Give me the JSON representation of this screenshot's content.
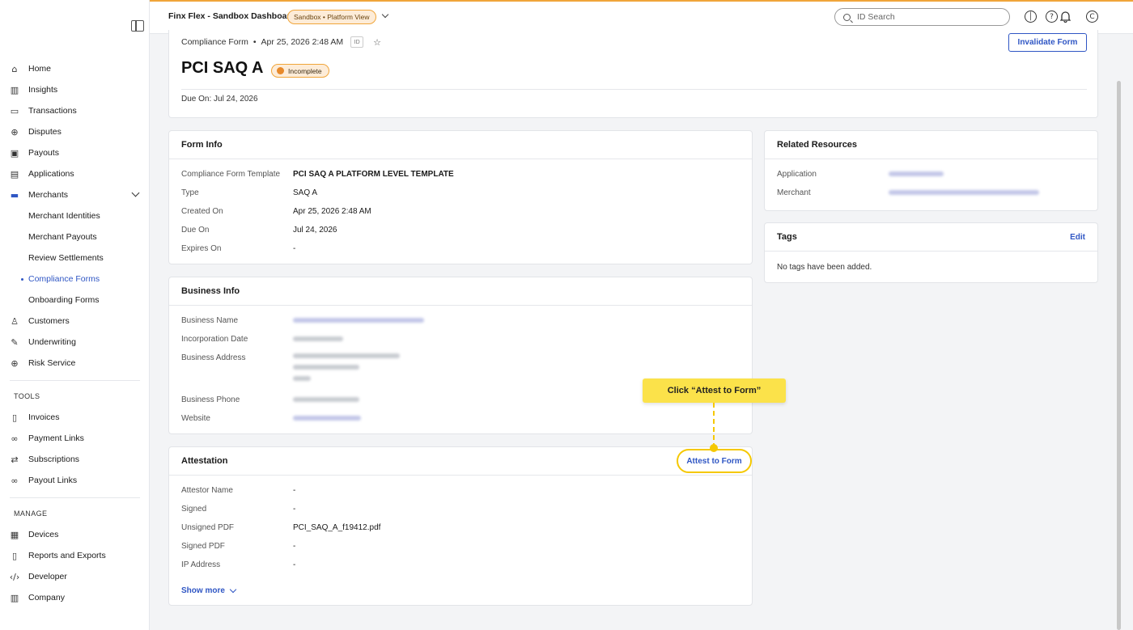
{
  "topbar": {
    "app_title": "Finx Flex - Sandbox Dashboard",
    "env_label": "Sandbox • Platform View",
    "search_placeholder": "ID Search"
  },
  "sidebar": {
    "items": [
      {
        "label": "Home",
        "icon": "home-icon"
      },
      {
        "label": "Insights",
        "icon": "chart-icon"
      },
      {
        "label": "Transactions",
        "icon": "card-icon"
      },
      {
        "label": "Disputes",
        "icon": "search-icon"
      },
      {
        "label": "Payouts",
        "icon": "payout-icon"
      },
      {
        "label": "Applications",
        "icon": "list-icon"
      },
      {
        "label": "Merchants",
        "icon": "merchant-icon"
      }
    ],
    "merchant_sub": [
      "Merchant Identities",
      "Merchant Payouts",
      "Review Settlements",
      "Compliance Forms",
      "Onboarding Forms"
    ],
    "items_after": [
      {
        "label": "Customers",
        "icon": "user-icon"
      },
      {
        "label": "Underwriting",
        "icon": "underwriting-icon"
      },
      {
        "label": "Risk Service",
        "icon": "risk-icon"
      }
    ],
    "tools_label": "TOOLS",
    "tools": [
      {
        "label": "Invoices",
        "icon": "invoice-icon"
      },
      {
        "label": "Payment Links",
        "icon": "link-icon"
      },
      {
        "label": "Subscriptions",
        "icon": "refresh-icon"
      },
      {
        "label": "Payout Links",
        "icon": "payout-link-icon"
      }
    ],
    "manage_label": "MANAGE",
    "manage": [
      {
        "label": "Devices",
        "icon": "device-icon"
      },
      {
        "label": "Reports and Exports",
        "icon": "report-icon"
      },
      {
        "label": "Developer",
        "icon": "code-icon"
      },
      {
        "label": "Company",
        "icon": "building-icon"
      }
    ]
  },
  "header": {
    "breadcrumb": "Compliance Form",
    "breadcrumb_sep": "•",
    "date": "Apr 25, 2026 2:48 AM",
    "id_chip": "ID",
    "title": "PCI SAQ A",
    "status": "Incomplete",
    "invalidate_label": "Invalidate Form",
    "due_on": "Due On: Jul 24, 2026"
  },
  "form_info": {
    "title": "Form Info",
    "rows": [
      {
        "k": "Compliance Form Template",
        "v": "PCI SAQ A PLATFORM LEVEL TEMPLATE"
      },
      {
        "k": "Type",
        "v": "SAQ A"
      },
      {
        "k": "Created On",
        "v": "Apr 25, 2026 2:48 AM"
      },
      {
        "k": "Due On",
        "v": "Jul 24, 2026"
      },
      {
        "k": "Expires On",
        "v": "-"
      }
    ]
  },
  "business_info": {
    "title": "Business Info",
    "labels": [
      "Business Name",
      "Incorporation Date",
      "Business Address",
      "Business Phone",
      "Website"
    ]
  },
  "attestation": {
    "title": "Attestation",
    "attest_label": "Attest to Form",
    "rows": [
      {
        "k": "Attestor Name",
        "v": "-"
      },
      {
        "k": "Signed",
        "v": "-"
      },
      {
        "k": "Unsigned PDF",
        "v": "PCI_SAQ_A_f19412.pdf"
      },
      {
        "k": "Signed PDF",
        "v": "-"
      },
      {
        "k": "IP Address",
        "v": "-"
      }
    ],
    "show_more": "Show more"
  },
  "tooltip": "Click “Attest to Form”",
  "related": {
    "title": "Related Resources",
    "labels": [
      "Application",
      "Merchant"
    ]
  },
  "tags": {
    "title": "Tags",
    "edit": "Edit",
    "empty": "No tags have been added."
  },
  "colors": {
    "accent": "#2f56c4",
    "warning": "#f0a53a",
    "highlight": "#f5c800"
  }
}
